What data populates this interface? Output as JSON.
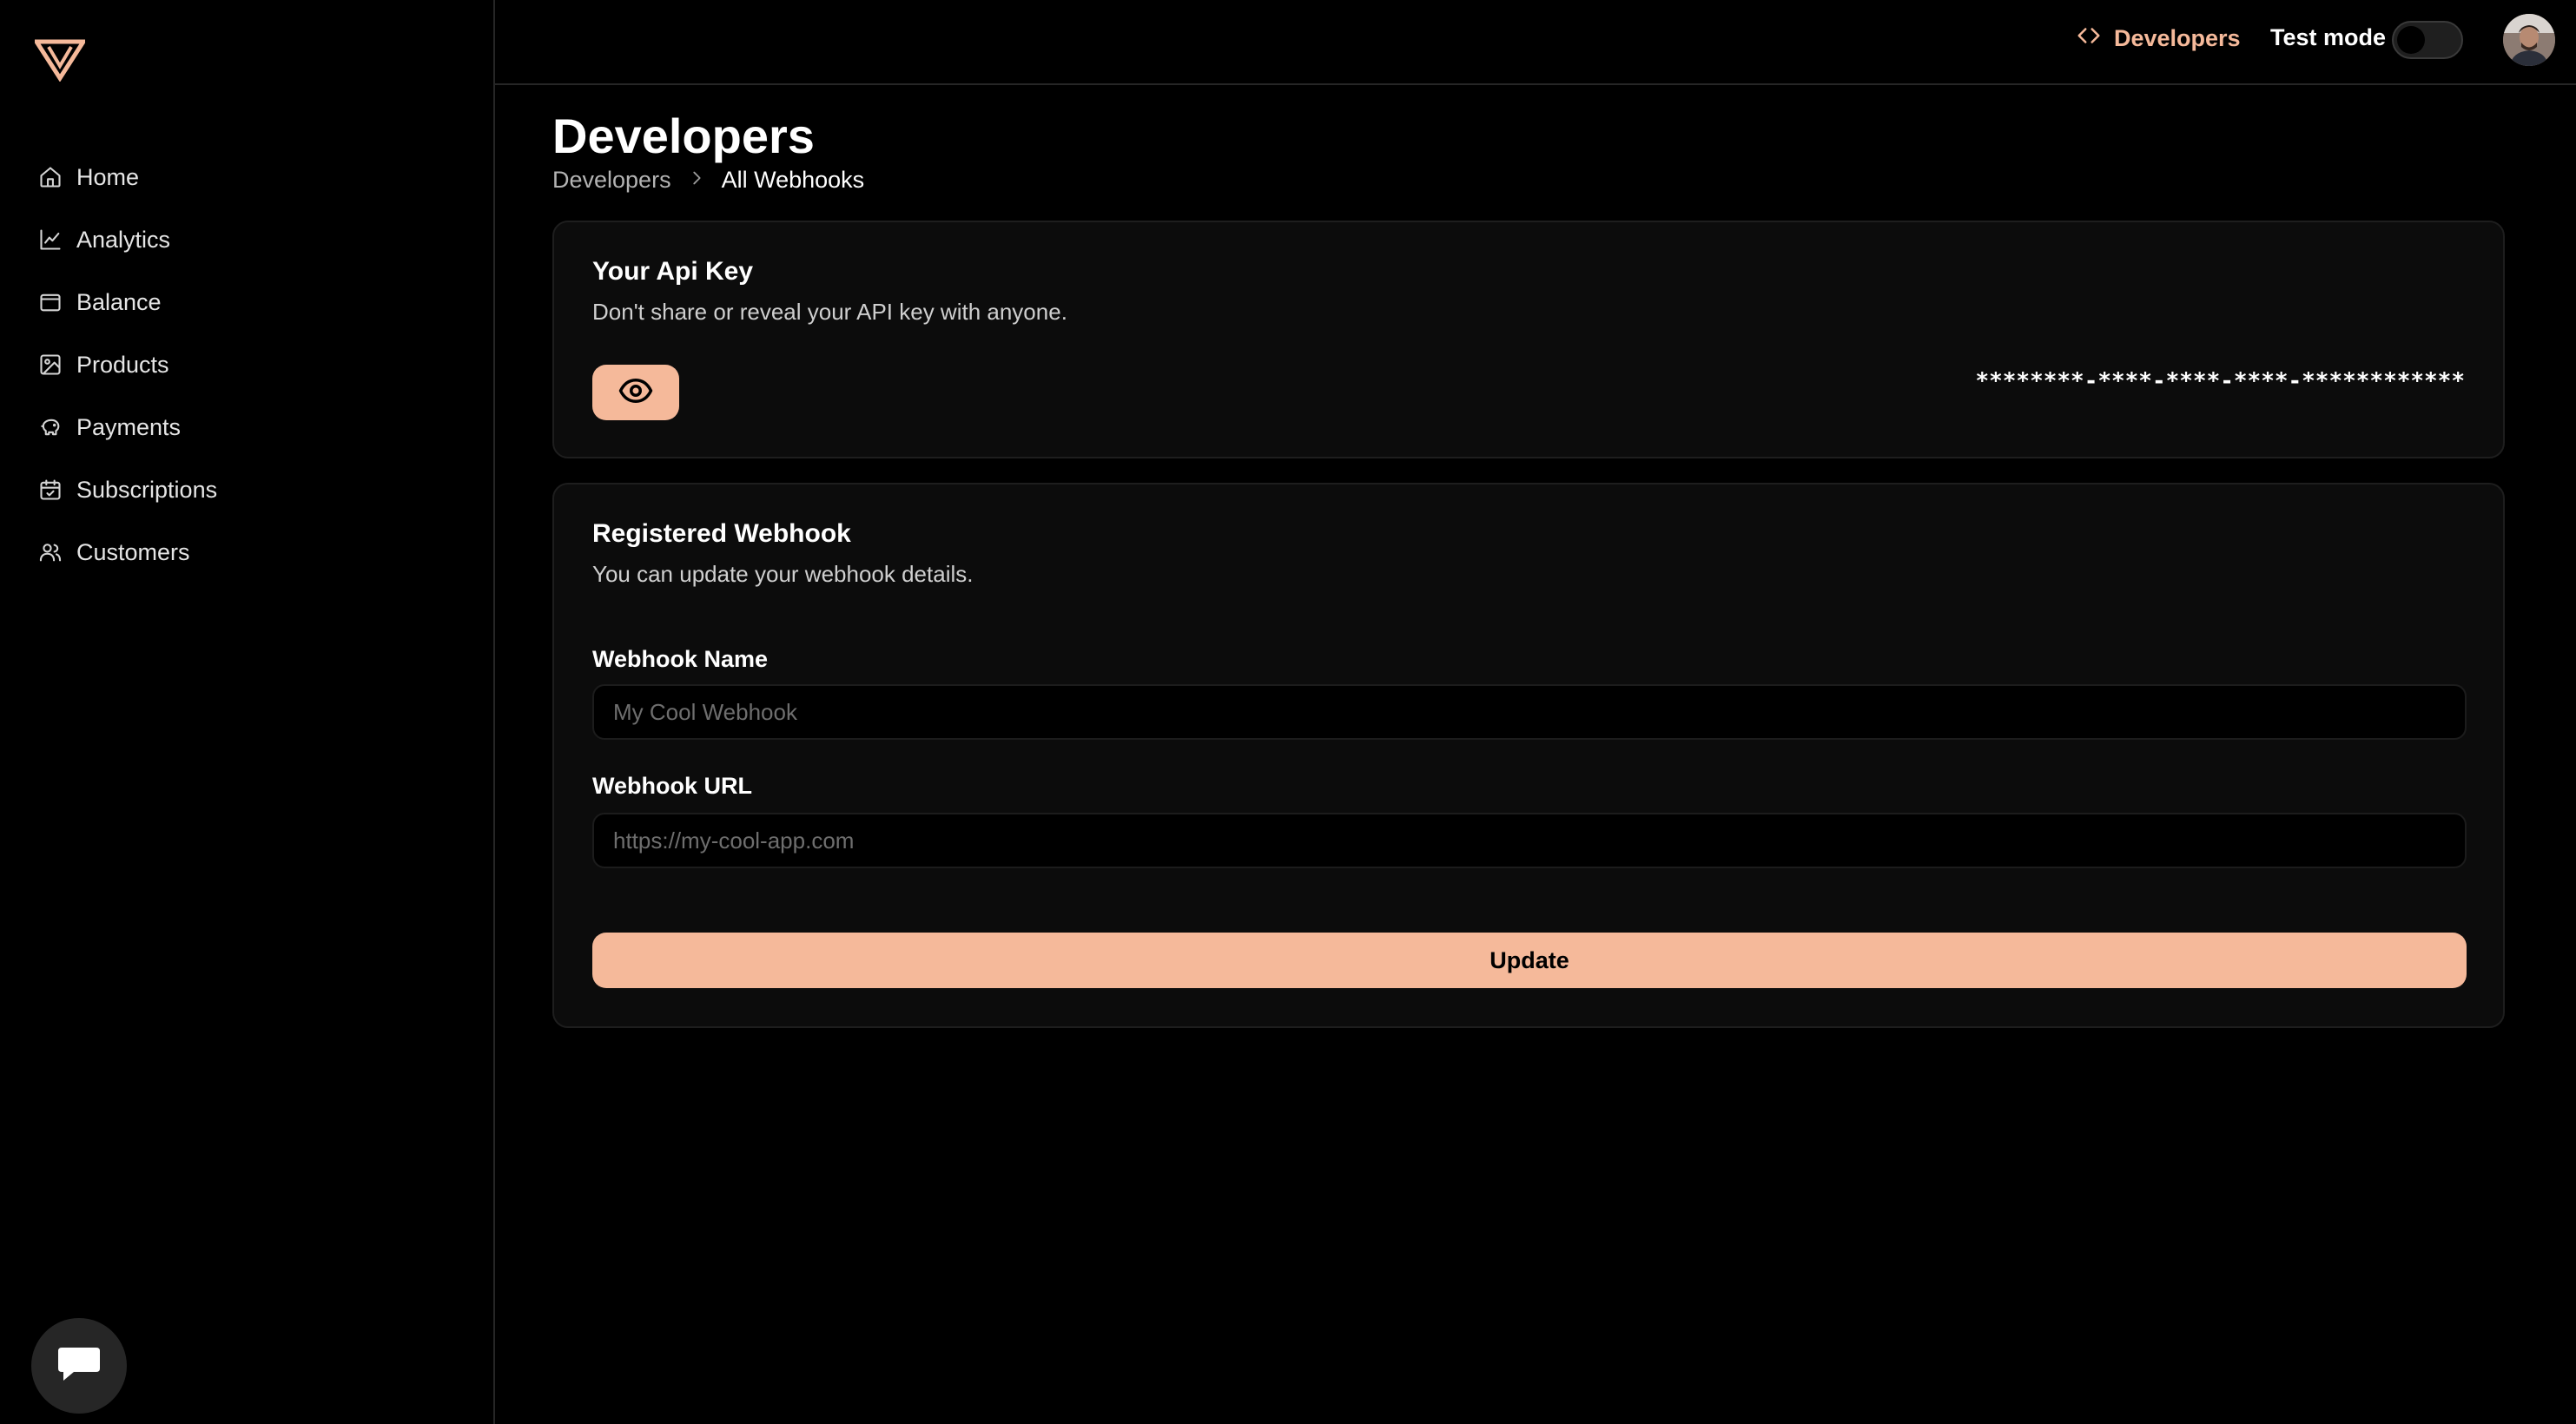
{
  "colors": {
    "accent": "#f5b99a",
    "background": "#000000",
    "card": "#0c0c0c",
    "border": "#1e1e1e"
  },
  "sidebar": {
    "logo": "brand-logo",
    "items": [
      {
        "label": "Home",
        "icon": "home-icon"
      },
      {
        "label": "Analytics",
        "icon": "chart-line-icon"
      },
      {
        "label": "Balance",
        "icon": "wallet-icon"
      },
      {
        "label": "Products",
        "icon": "image-icon"
      },
      {
        "label": "Payments",
        "icon": "piggy-bank-icon"
      },
      {
        "label": "Subscriptions",
        "icon": "calendar-check-icon"
      },
      {
        "label": "Customers",
        "icon": "users-icon"
      }
    ],
    "chat_icon": "chat-bubble-icon"
  },
  "topbar": {
    "developers_label": "Developers",
    "test_mode_label": "Test mode",
    "test_mode_on": false
  },
  "header": {
    "title": "Developers",
    "breadcrumb": [
      "Developers",
      "All Webhooks"
    ]
  },
  "api_key_card": {
    "title": "Your Api Key",
    "subtitle": "Don't share or reveal your API key with anyone.",
    "masked_key": "********-****-****-****-************"
  },
  "webhook_card": {
    "title": "Registered Webhook",
    "subtitle": "You can update your webhook details.",
    "name_label": "Webhook Name",
    "name_placeholder": "My Cool Webhook",
    "name_value": "",
    "url_label": "Webhook URL",
    "url_placeholder": "https://my-cool-app.com",
    "url_value": "",
    "submit_label": "Update"
  }
}
